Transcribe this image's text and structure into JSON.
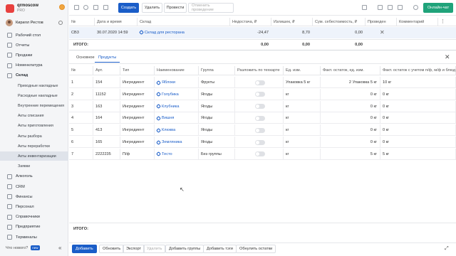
{
  "app": {
    "name": "qrmoscow",
    "plan": "PRO"
  },
  "user": {
    "name": "Кирилл Рестов"
  },
  "nav": [
    {
      "label": "Рабочий стол",
      "sub": false,
      "active": false
    },
    {
      "label": "Отчеты",
      "sub": false,
      "active": false
    },
    {
      "label": "Продажи",
      "sub": false,
      "active": false
    },
    {
      "label": "Номенклатура",
      "sub": false,
      "active": false
    },
    {
      "label": "Склад",
      "sub": false,
      "active": false,
      "bold": true
    },
    {
      "label": "Приходные накладные",
      "sub": true
    },
    {
      "label": "Расходные накладные",
      "sub": true
    },
    {
      "label": "Внутренние перемещения",
      "sub": true
    },
    {
      "label": "Акты списания",
      "sub": true
    },
    {
      "label": "Акты приготовления",
      "sub": true
    },
    {
      "label": "Акты разбора",
      "sub": true
    },
    {
      "label": "Акты переработки",
      "sub": true
    },
    {
      "label": "Акты инвентаризации",
      "sub": true,
      "active": true
    },
    {
      "label": "Заявки",
      "sub": true
    },
    {
      "label": "Алкоголь",
      "sub": false
    },
    {
      "label": "CRM",
      "sub": false
    },
    {
      "label": "Финансы",
      "sub": false
    },
    {
      "label": "Персонал",
      "sub": false
    },
    {
      "label": "Справочники",
      "sub": false
    },
    {
      "label": "Предприятие",
      "sub": false
    },
    {
      "label": "Терминалы",
      "sub": false
    }
  ],
  "help": {
    "label": "Что нового?",
    "badge": "new"
  },
  "toolbar": {
    "create": "Создать",
    "delete": "Удалить",
    "post": "Провести",
    "cancel_post": "Отменить проведение",
    "chat": "Онлайн-чат"
  },
  "top_table": {
    "headers": [
      "№",
      "Дата и время",
      "Склад",
      "Недостача, ₽",
      "Излишек, ₽",
      "Сум. себестоимость, ₽",
      "Проведен",
      "Комментарий"
    ],
    "row": {
      "num": "СВ3",
      "date": "30.07.2020 14:59",
      "warehouse": "Склад для ресторана",
      "shortage": "-24,47",
      "surplus": "8,70",
      "cost": "0,00",
      "posted": "✕",
      "comment": ""
    },
    "total_label": "ИТОГО:",
    "total_shortage": "0,00",
    "total_surplus": "0,00",
    "total_cost": "0,00"
  },
  "tabs": [
    "Основное",
    "Продукты"
  ],
  "table": {
    "headers": [
      "№",
      "Арт.",
      "Тип",
      "Наименование",
      "Группа",
      "Разложить по техкарте",
      "Ед. изм.",
      "Факт. остаток, ед. изм.",
      "Факт. остаток с учетом п/ф, м/ф и блюд, ед. изм."
    ],
    "rows": [
      {
        "n": "1",
        "art": "154",
        "type": "Ингредиент",
        "name": "Яблоки",
        "group": "Фрукты",
        "unit": "Упаковка 5 кг",
        "fact": "2 Упаковка 5 кг",
        "fact2": "10 кг"
      },
      {
        "n": "2",
        "art": "11152",
        "type": "Ингредиент",
        "name": "Голубика",
        "group": "Ягоды",
        "unit": "кг",
        "fact": "0 кг",
        "fact2": "0 кг"
      },
      {
        "n": "3",
        "art": "163",
        "type": "Ингредиент",
        "name": "Клубника",
        "group": "Ягоды",
        "unit": "кг",
        "fact": "0 кг",
        "fact2": "0 кг"
      },
      {
        "n": "4",
        "art": "164",
        "type": "Ингредиент",
        "name": "Вишня",
        "group": "Ягоды",
        "unit": "кг",
        "fact": "0 кг",
        "fact2": "0 кг"
      },
      {
        "n": "5",
        "art": "413",
        "type": "Ингредиент",
        "name": "Клюква",
        "group": "Ягоды",
        "unit": "кг",
        "fact": "0 кг",
        "fact2": "0 кг"
      },
      {
        "n": "6",
        "art": "165",
        "type": "Ингредиент",
        "name": "Земляника",
        "group": "Ягоды",
        "unit": "кг",
        "fact": "0 кг",
        "fact2": "0 кг"
      },
      {
        "n": "7",
        "art": "2222235",
        "type": "П/ф",
        "name": "Тесто",
        "group": "Без группы",
        "unit": "кг",
        "fact": "5 кг",
        "fact2": "5 кг"
      }
    ],
    "total_label": "ИТОГО:"
  },
  "bottom": {
    "add": "Добавить",
    "refresh": "Обновить",
    "export": "Экспорт",
    "delete": "Удалить",
    "add_groups": "Добавить группы",
    "add_tags": "Добавить тэги",
    "zero": "Обнулить остатки"
  }
}
